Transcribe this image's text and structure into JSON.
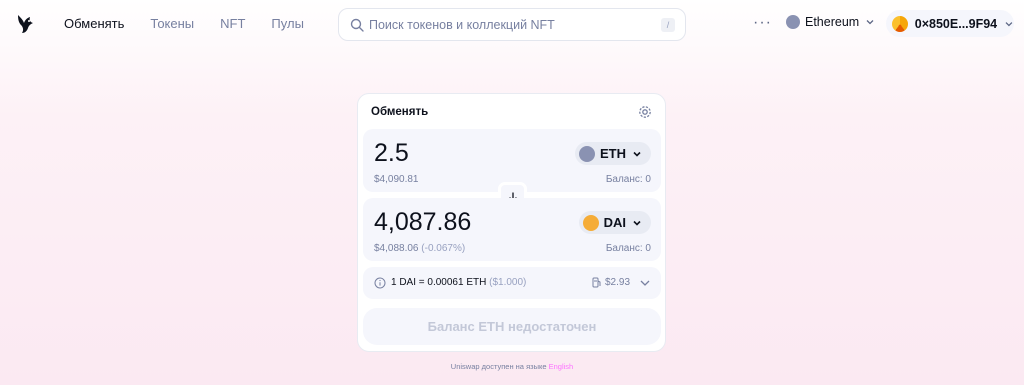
{
  "header": {
    "nav": [
      "Обменять",
      "Токены",
      "NFT",
      "Пулы"
    ],
    "active_nav": "Обменять",
    "search": {
      "placeholder": "Поиск токенов и коллекций NFT",
      "shortcut": "/"
    },
    "more_label": "···",
    "network": "Ethereum",
    "account": "0×850E...9F94"
  },
  "swap": {
    "title": "Обменять",
    "input": {
      "amount": "2.5",
      "fiat": "$4,090.81",
      "token": "ETH",
      "balance": "Баланс: 0"
    },
    "output": {
      "amount": "4,087.86",
      "fiat": "$4,088.06",
      "fiat_delta": "(-0.067%)",
      "token": "DAI",
      "balance": "Баланс: 0"
    },
    "rate": {
      "text": "1 DAI = 0.00061 ETH",
      "fiat": "($1.000)",
      "gas": "$2.93"
    },
    "submit_label": "Баланс ETH недостаточен"
  },
  "footer": {
    "text": "Uniswap доступен на языке",
    "language": "English"
  },
  "colors": {
    "accent": "#fc72ff",
    "eth": "#8a92b2",
    "dai": "#f5ac37"
  }
}
